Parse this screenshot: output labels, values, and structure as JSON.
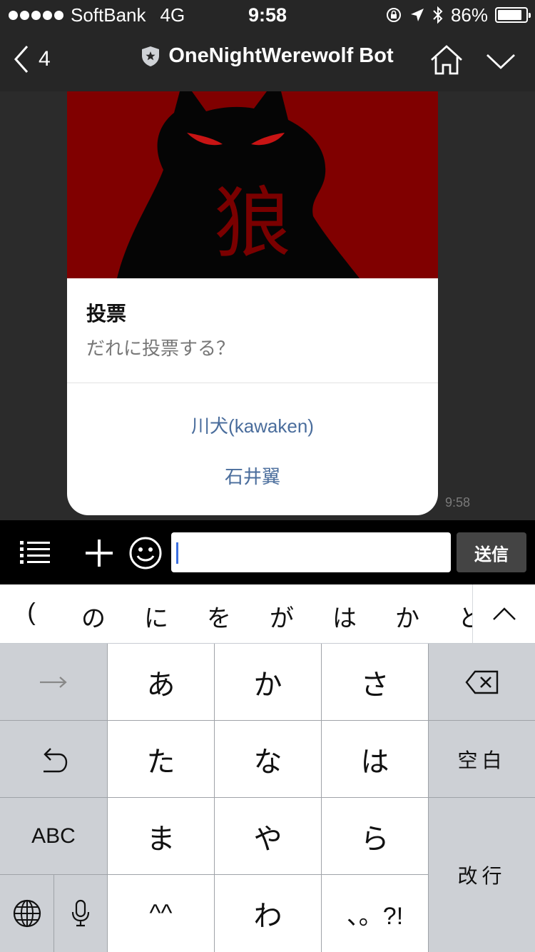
{
  "status_bar": {
    "carrier": "SoftBank",
    "network": "4G",
    "time": "9:58",
    "battery_percent": "86%",
    "battery_level": 0.86
  },
  "nav": {
    "back_count": "4",
    "title": "OneNightWerewolf Bot"
  },
  "card": {
    "image_glyph": "狼",
    "title": "投票",
    "subtitle": "だれに投票する？",
    "actions": [
      "川犬(kawaken)",
      "石井翼"
    ],
    "time": "9:58"
  },
  "input_bar": {
    "value": "",
    "send_label": "送信"
  },
  "suggestions": [
    "(",
    "の",
    "に",
    "を",
    "が",
    "は",
    "か",
    "と"
  ],
  "keyboard": {
    "row1": [
      "あ",
      "か",
      "さ"
    ],
    "row2": [
      "た",
      "な",
      "は"
    ],
    "row3": [
      "ま",
      "や",
      "ら"
    ],
    "row4": [
      "^^",
      "わ",
      "、。?!"
    ],
    "abc_label": "ABC",
    "space_label": "空白",
    "return_label": "改行"
  },
  "colors": {
    "bar": "#262626",
    "chat_bg": "#2b2b2b",
    "card_image_bg": "#800000",
    "action_text": "#4a6d9c",
    "key_char": "#ffffff",
    "key_func": "#cdd0d5"
  }
}
